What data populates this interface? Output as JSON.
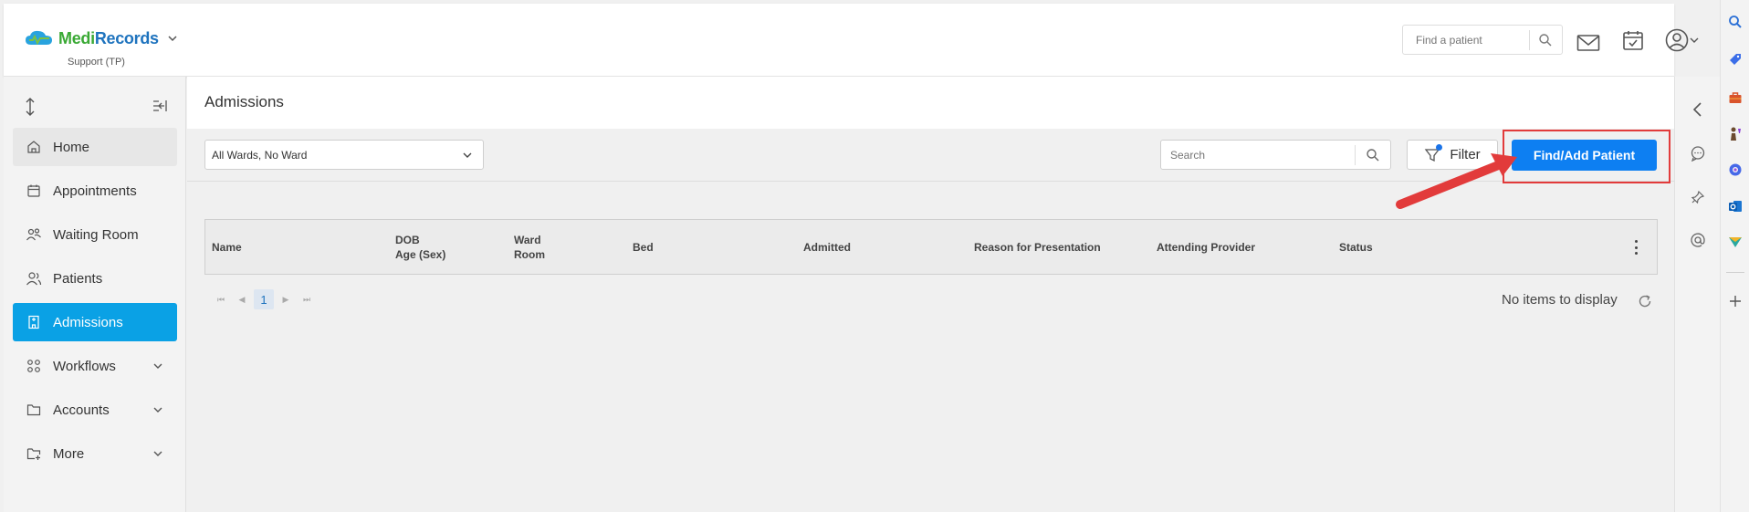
{
  "app": {
    "brand_part1": "Medi",
    "brand_part2": "Records",
    "tenant": "Support (TP)"
  },
  "header": {
    "search_placeholder": "Find a patient"
  },
  "sidebar": {
    "items": [
      {
        "label": "Home",
        "icon": "home-icon"
      },
      {
        "label": "Appointments",
        "icon": "calendar-icon"
      },
      {
        "label": "Waiting Room",
        "icon": "people-icon"
      },
      {
        "label": "Patients",
        "icon": "patients-icon"
      },
      {
        "label": "Admissions",
        "icon": "building-icon",
        "active": true
      },
      {
        "label": "Workflows",
        "icon": "workflow-icon",
        "expandable": true
      },
      {
        "label": "Accounts",
        "icon": "folder-icon",
        "expandable": true
      },
      {
        "label": "More",
        "icon": "folder-plus-icon",
        "expandable": true
      }
    ]
  },
  "page": {
    "title": "Admissions",
    "ward_filter": "All Wards, No Ward",
    "search_placeholder": "Search",
    "filter_label": "Filter",
    "find_add_label": "Find/Add Patient"
  },
  "grid": {
    "columns": [
      {
        "line1": "Name",
        "line2": ""
      },
      {
        "line1": "DOB",
        "line2": "Age (Sex)"
      },
      {
        "line1": "Ward",
        "line2": "Room"
      },
      {
        "line1": "Bed",
        "line2": ""
      },
      {
        "line1": "Admitted",
        "line2": ""
      },
      {
        "line1": "Reason for Presentation",
        "line2": ""
      },
      {
        "line1": "Attending Provider",
        "line2": ""
      },
      {
        "line1": "Status",
        "line2": ""
      }
    ],
    "current_page": "1",
    "empty_text": "No items to display"
  },
  "colors": {
    "active_nav": "#0aa1e5",
    "primary_button": "#0d7ff2",
    "highlight": "#e23b3b"
  }
}
